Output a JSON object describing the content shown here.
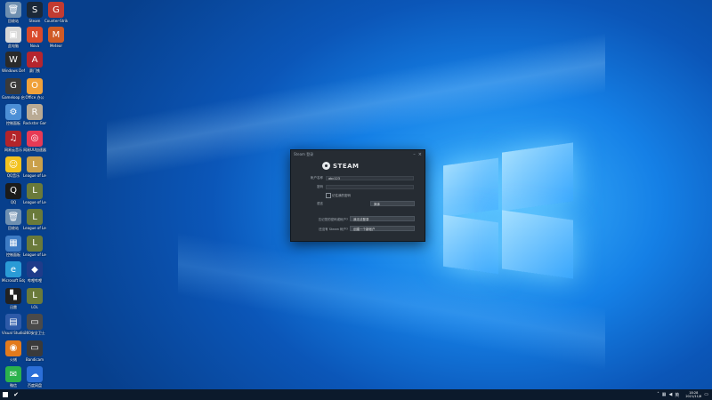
{
  "desktop_icons": [
    {
      "label": "回收站",
      "color": "#6e8fb0",
      "glyph": "🗑"
    },
    {
      "label": "Steam",
      "color": "#1b2838",
      "glyph": "S"
    },
    {
      "label": "Counter-Strike Global Offensive",
      "color": "#c23b32",
      "glyph": "G"
    },
    {
      "label": "此电脑",
      "color": "#d7d7d7",
      "glyph": "▣"
    },
    {
      "label": "Nova",
      "color": "#d94a2b",
      "glyph": "N"
    },
    {
      "label": "Meteor",
      "color": "#cf5a25",
      "glyph": "M"
    },
    {
      "label": "Windows Defender",
      "color": "#2a2a2a",
      "glyph": "W"
    },
    {
      "label": "赛门铁",
      "color": "#b5252e",
      "glyph": "A"
    },
    {
      "label": "Gameloop 启动器",
      "color": "#3a3a3a",
      "glyph": "G"
    },
    {
      "label": "Office 办公",
      "color": "#f0a13a",
      "glyph": "O"
    },
    {
      "label": "控制面板",
      "color": "#4c8fd6",
      "glyph": "⚙"
    },
    {
      "label": "Rockstar Games",
      "color": "#b9aa94",
      "glyph": "R"
    },
    {
      "label": "网易云音乐",
      "color": "#b3242a",
      "glyph": "♫"
    },
    {
      "label": "网易UU加速器",
      "color": "#e73a55",
      "glyph": "◎"
    },
    {
      "label": "QQ音乐",
      "color": "#f3c21e",
      "glyph": "☺"
    },
    {
      "label": "League of Legends",
      "color": "#caa04a",
      "glyph": "L"
    },
    {
      "label": "QQ",
      "color": "#1b1b1b",
      "glyph": "Q"
    },
    {
      "label": "League of Legends",
      "color": "#6a7a3a",
      "glyph": "L"
    },
    {
      "label": "回收站",
      "color": "#6e8fb0",
      "glyph": "🗑"
    },
    {
      "label": "League of Legends",
      "color": "#6a7a3a",
      "glyph": "L"
    },
    {
      "label": "控制面板",
      "color": "#3d7bc4",
      "glyph": "▦"
    },
    {
      "label": "League of Legends",
      "color": "#6a7a3a",
      "glyph": "L"
    },
    {
      "label": "Microsoft Edge",
      "color": "#2a9bd6",
      "glyph": "e"
    },
    {
      "label": "哔哩哔哩",
      "color": "#1f3b8a",
      "glyph": "◆"
    },
    {
      "label": "迅雷",
      "color": "#222",
      "glyph": "▚"
    },
    {
      "label": "LOL",
      "color": "#6a7a3a",
      "glyph": "L"
    },
    {
      "label": "Visual Studio",
      "color": "#2d5aa8",
      "glyph": "▤"
    },
    {
      "label": "360安全卫士",
      "color": "#4a4a4a",
      "glyph": "▭"
    },
    {
      "label": "火绒",
      "color": "#e27a1c",
      "glyph": "◉"
    },
    {
      "label": "Bandicam",
      "color": "#3a3a3a",
      "glyph": "▭"
    },
    {
      "label": "微信",
      "color": "#2bb24c",
      "glyph": "✉"
    },
    {
      "label": "百度网盘",
      "color": "#2c6fd8",
      "glyph": "☁"
    }
  ],
  "steam_window": {
    "title": "Steam 登录",
    "minimize": "–",
    "close": "×",
    "brand": "STEAM",
    "account_label": "帐户名称",
    "account_value": "abc123",
    "password_label": "密码",
    "password_value": "",
    "remember_label": "记住我的密码",
    "language_label": "语言",
    "language_value": "简体",
    "forgot_question": "忘记您的密码或帐户?",
    "forgot_button": "我无法登录",
    "create_question": "还没有 Steam 帐户?",
    "create_button": "创建一个新帐户"
  },
  "taskbar": {
    "clock_time": "18:28",
    "clock_date": "2021/11/6",
    "tray_lang": "英"
  }
}
